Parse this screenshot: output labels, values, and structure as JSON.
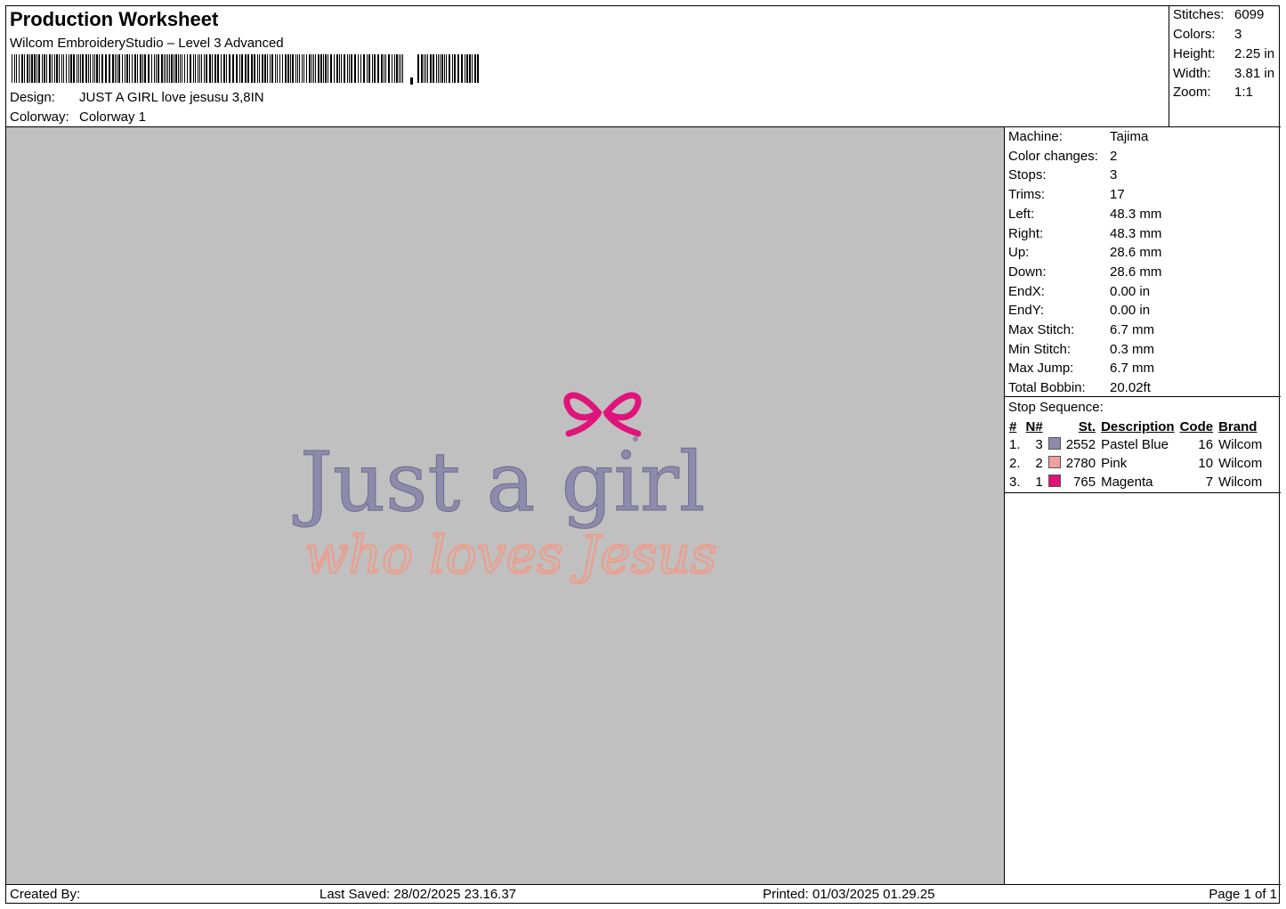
{
  "header": {
    "title": "Production Worksheet",
    "software": "Wilcom EmbroideryStudio – Level 3 Advanced",
    "design_label": "Design:",
    "design_value": "JUST A GIRL love jesusu 3,8IN",
    "colorway_label": "Colorway:",
    "colorway_value": "Colorway 1"
  },
  "stats": {
    "stitches_label": "Stitches:",
    "stitches_value": "6099",
    "colors_label": "Colors:",
    "colors_value": "3",
    "height_label": "Height:",
    "height_value": "2.25 in",
    "width_label": "Width:",
    "width_value": "3.81 in",
    "zoom_label": "Zoom:",
    "zoom_value": "1:1"
  },
  "properties": [
    {
      "label": "Machine:",
      "value": "Tajima"
    },
    {
      "label": "Color changes:",
      "value": "2"
    },
    {
      "label": "Stops:",
      "value": "3"
    },
    {
      "label": "Trims:",
      "value": "17"
    },
    {
      "label": "Left:",
      "value": "48.3 mm"
    },
    {
      "label": "Right:",
      "value": "48.3 mm"
    },
    {
      "label": "Up:",
      "value": "28.6 mm"
    },
    {
      "label": "Down:",
      "value": "28.6 mm"
    },
    {
      "label": "EndX:",
      "value": "0.00 in"
    },
    {
      "label": "EndY:",
      "value": "0.00 in"
    },
    {
      "label": "Max Stitch:",
      "value": "6.7 mm"
    },
    {
      "label": "Min Stitch:",
      "value": "0.3 mm"
    },
    {
      "label": "Max Jump:",
      "value": "6.7 mm"
    },
    {
      "label": "Total Bobbin:",
      "value": "20.02ft"
    }
  ],
  "stop_sequence": {
    "title": "Stop Sequence:",
    "columns": [
      "#",
      "N#",
      "St.",
      "Description",
      "Code",
      "Brand"
    ],
    "rows": [
      {
        "num": "1.",
        "n": "3",
        "color": "#8e8aab",
        "st": "2552",
        "description": "Pastel Blue",
        "code": "16",
        "brand": "Wilcom"
      },
      {
        "num": "2.",
        "n": "2",
        "color": "#f0a0a0",
        "st": "2780",
        "description": "Pink",
        "code": "10",
        "brand": "Wilcom"
      },
      {
        "num": "3.",
        "n": "1",
        "color": "#e0137a",
        "st": "765",
        "description": "Magenta",
        "code": "7",
        "brand": "Wilcom"
      }
    ]
  },
  "design_preview": {
    "line1": "Just a girl",
    "line2": "who loves Jesus",
    "colors": {
      "text1": "#8e8aab",
      "text2": "#e8a090",
      "bow": "#e0137a",
      "background": "#c0c0c0"
    }
  },
  "footer": {
    "created_by": "Created By:",
    "last_saved": "Last Saved: 28/02/2025 23.16.37",
    "printed": "Printed: 01/03/2025 01.29.25",
    "page": "Page 1 of 1"
  }
}
